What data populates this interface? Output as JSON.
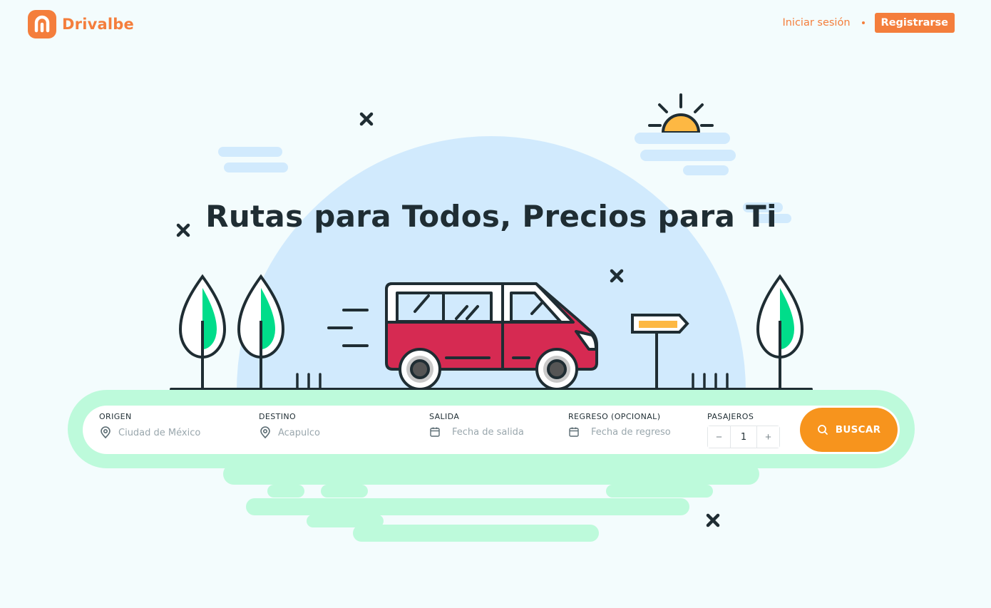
{
  "brand": {
    "name": "Drivalbe",
    "color": "#f47e3c"
  },
  "nav": {
    "login_label": "Iniciar sesión",
    "register_label": "Registrarse"
  },
  "hero": {
    "title": "Rutas para Todos, Precios para Ti"
  },
  "search": {
    "origin": {
      "label": "ORIGEN",
      "placeholder": "Ciudad de México",
      "icon": "location-pin-icon"
    },
    "destination": {
      "label": "DESTINO",
      "placeholder": "Acapulco",
      "icon": "location-pin-icon"
    },
    "departure": {
      "label": "SALIDA",
      "placeholder": "Fecha de salida",
      "icon": "calendar-icon"
    },
    "return": {
      "label": "REGRESO (OPCIONAL)",
      "placeholder": "Fecha de regreso",
      "icon": "calendar-icon"
    },
    "passengers": {
      "label": "PASAJEROS",
      "value": "1",
      "minus": "−",
      "plus": "+"
    },
    "submit_label": "BUSCAR",
    "submit_color": "#f7941d"
  },
  "colors": {
    "background": "#f3fcfd",
    "hill": "#d1eafd",
    "ground": "#bdfadb",
    "van": "#d62a52",
    "tree": "#00dd8a",
    "sun": "#fdb843",
    "outline": "#1f2d33"
  }
}
